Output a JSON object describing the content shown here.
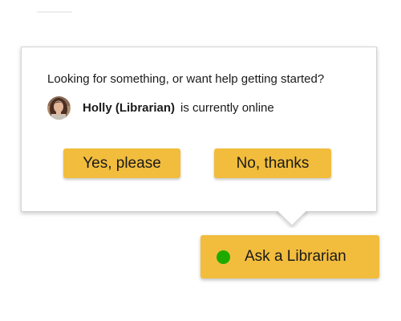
{
  "popup": {
    "prompt": "Looking for something, or want help getting started?",
    "librarian_name": "Holly (Librarian)",
    "status_text": "is currently online",
    "avatar_icon": "librarian-photo",
    "yes_label": "Yes, please",
    "no_label": "No, thanks"
  },
  "launcher": {
    "label": "Ask a Librarian",
    "status_icon": "online-dot",
    "status_color": "#1faa00"
  },
  "colors": {
    "button_yellow": "#f2bd3d",
    "text": "#1a1a1a",
    "popup_border": "#d4d4d4"
  }
}
